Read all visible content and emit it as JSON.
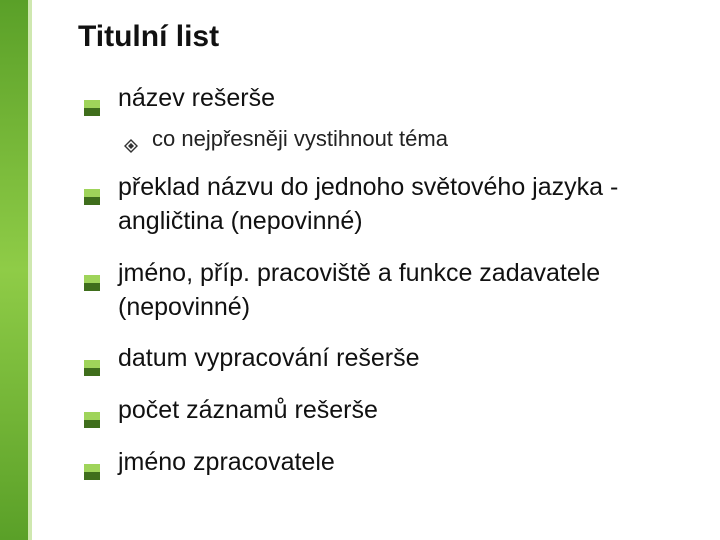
{
  "title": "Titulní list",
  "bullets": [
    {
      "text": "název rešerše",
      "sub": [
        {
          "text": "co nejpřesněji vystihnout téma"
        }
      ]
    },
    {
      "text": "překlad názvu do jednoho světového jazyka - angličtina (nepovinné)"
    },
    {
      "text": "jméno, příp. pracoviště a funkce zadavatele (nepovinné)"
    },
    {
      "text": "datum vypracování rešerše"
    },
    {
      "text": "počet záznamů rešerše"
    },
    {
      "text": "jméno zpracovatele"
    }
  ],
  "colors": {
    "bullet_fill": "#9fd45a",
    "bullet_stroke": "#3f6e1c",
    "diamond_stroke": "#333"
  }
}
